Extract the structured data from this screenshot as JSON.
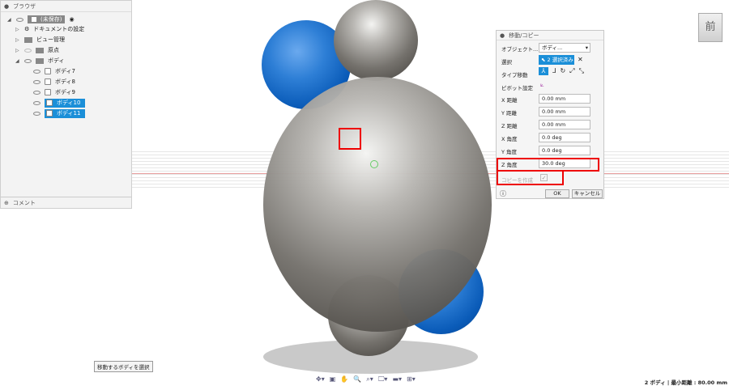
{
  "browser": {
    "title": "ブラウザ",
    "root": "(未保存)",
    "items": [
      "ドキュメントの設定",
      "ビュー管理",
      "原点",
      "ボディ"
    ],
    "bodies": [
      {
        "label": "ボディ7",
        "selected": false
      },
      {
        "label": "ボディ8",
        "selected": false
      },
      {
        "label": "ボディ9",
        "selected": false
      },
      {
        "label": "ボディ10",
        "selected": true
      },
      {
        "label": "ボディ11",
        "selected": true
      }
    ],
    "comment": "コメント"
  },
  "dialog": {
    "title": "移動/コピー",
    "object_label": "オブジェクト...",
    "object_value": "ボディ...",
    "select_label": "選択",
    "select_value": "2 選択済み",
    "type_label": "タイプ移動",
    "pivot_label": "ピボット設定",
    "fields": [
      {
        "label": "X 距離",
        "value": "0.00 mm"
      },
      {
        "label": "Y 距離",
        "value": "0.00 mm"
      },
      {
        "label": "Z 距離",
        "value": "0.00 mm"
      },
      {
        "label": "X 角度",
        "value": "0.0 deg"
      },
      {
        "label": "Y 角度",
        "value": "0.0 deg"
      },
      {
        "label": "Z 角度",
        "value": "30.0 deg"
      }
    ],
    "copy_label": "コピーを作成",
    "copy_checked": true,
    "ok": "OK",
    "cancel": "キャンセル"
  },
  "viewcube": {
    "face": "前"
  },
  "tooltip": "移動するボディを選択",
  "status": "2 ボディ | 最小距離 : 80.00 mm",
  "colors": {
    "selection": "#1b8fd8",
    "highlight": "#e00000"
  }
}
